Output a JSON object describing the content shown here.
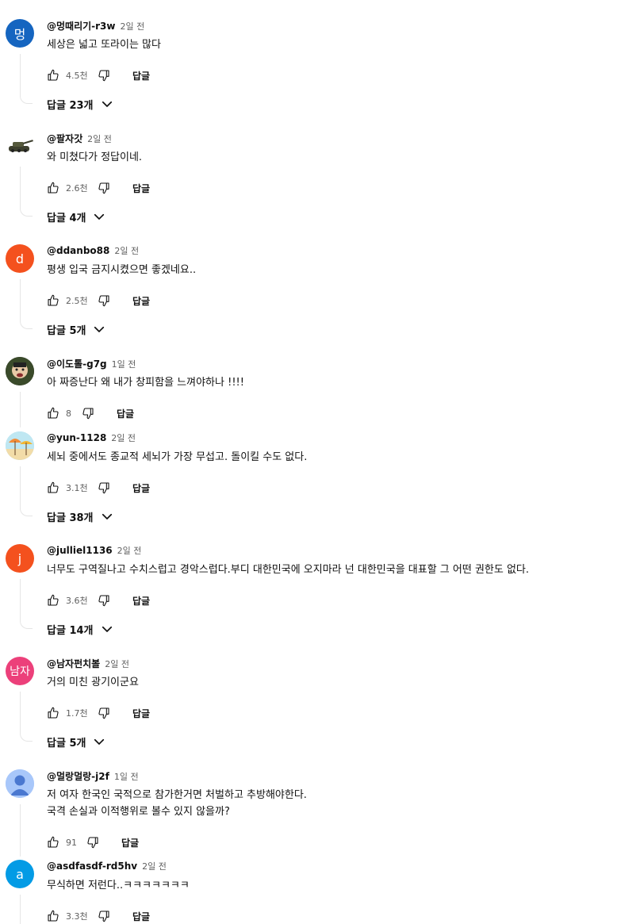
{
  "labels": {
    "reply": "답글"
  },
  "comments": [
    {
      "author": "@멍때리기-r3w",
      "time": "2일 전",
      "text": [
        "세상은 넓고 또라이는 많다"
      ],
      "likes": "4.5천",
      "replies": "답글 23개",
      "avatar": {
        "letter": "멍",
        "color": "#1565c0",
        "kind": "letter"
      }
    },
    {
      "author": "@팔자갓",
      "time": "2일 전",
      "text": [
        "와 미쳤다가 정답이네."
      ],
      "likes": "2.6천",
      "replies": "답글 4개",
      "avatar": {
        "letter": "",
        "color": "#ffffff",
        "kind": "tank"
      }
    },
    {
      "author": "@ddanbo88",
      "time": "2일 전",
      "text": [
        "평생 입국 금지시켰으면 좋겠네요.."
      ],
      "likes": "2.5천",
      "replies": "답글 5개",
      "avatar": {
        "letter": "d",
        "color": "#f4511e",
        "kind": "letter"
      }
    },
    {
      "author": "@이도톨-g7g",
      "time": "1일 전",
      "text": [
        "아 짜증난다 왜 내가 창피함을 느껴야하나 !!!!"
      ],
      "likes": "8",
      "replies": "",
      "avatar": {
        "letter": "",
        "color": "#2e2e2e",
        "kind": "photo"
      }
    },
    {
      "author": "@yun-1128",
      "time": "2일 전",
      "text": [
        "세뇌 중에서도 종교적 세뇌가 가장 무섭고. 돌이킬 수도 없다."
      ],
      "likes": "3.1천",
      "replies": "답글 38개",
      "avatar": {
        "letter": "",
        "color": "#9fd6e8",
        "kind": "beach"
      }
    },
    {
      "author": "@julliel1136",
      "time": "2일 전",
      "text": [
        "너무도 구역질나고 수치스럽고 경악스럽다.부디 대한민국에 오지마라 넌 대한민국을 대표할  그 어떤 권한도 없다."
      ],
      "likes": "3.6천",
      "replies": "답글 14개",
      "avatar": {
        "letter": "j",
        "color": "#f4511e",
        "kind": "letter"
      }
    },
    {
      "author": "@남자펀치볼",
      "time": "2일 전",
      "text": [
        "거의 미친  광기이군요"
      ],
      "likes": "1.7천",
      "replies": "답글 5개",
      "avatar": {
        "letter": "남자",
        "color": "#ec407a",
        "kind": "letter"
      }
    },
    {
      "author": "@멀랑멀랑-j2f",
      "time": "1일 전",
      "text": [
        "저 여자 한국인 국적으로 참가한거면 처벌하고 추방해야한다.",
        "국격 손실과 이적행위로 볼수 있지 않을까?"
      ],
      "likes": "91",
      "replies": "",
      "avatar": {
        "letter": "",
        "color": "#a8c7fa",
        "kind": "default"
      }
    },
    {
      "author": "@asdfasdf-rd5hv",
      "time": "2일 전",
      "text": [
        "무식하면 저런다..ㅋㅋㅋㅋㅋㅋㅋ"
      ],
      "likes": "3.3천",
      "replies": "",
      "avatar": {
        "letter": "a",
        "color": "#039be5",
        "kind": "letter"
      }
    }
  ]
}
